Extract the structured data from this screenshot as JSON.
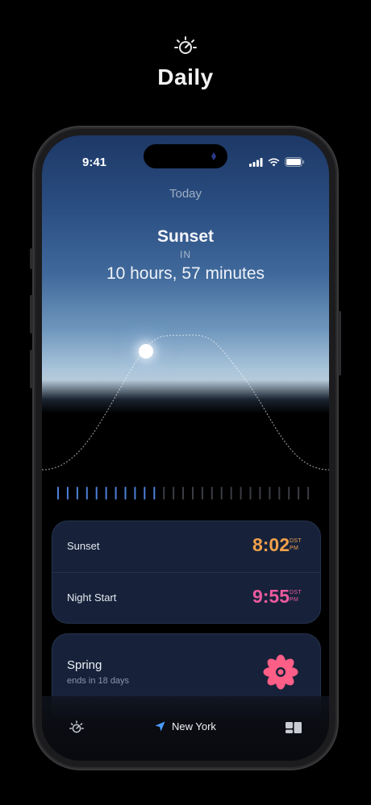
{
  "app": {
    "name": "Daily",
    "logo_icon": "sun-dial-icon"
  },
  "status_bar": {
    "time": "9:41"
  },
  "sky": {
    "day_label": "Today"
  },
  "event": {
    "title": "Sunset",
    "in_label": "IN",
    "countdown": "10 hours, 57 minutes"
  },
  "timeline": {
    "total_ticks": 27,
    "elapsed_ticks": 11,
    "elapsed_color": "#4d7fd6",
    "remaining_color": "#3a3d44"
  },
  "times": [
    {
      "label": "Sunset",
      "time": "8:02",
      "zone": "DST",
      "period": "PM",
      "color": "#f0a04b"
    },
    {
      "label": "Night Start",
      "time": "9:55",
      "zone": "DST",
      "period": "PM",
      "color": "#ec5a9e"
    }
  ],
  "season": {
    "name": "Spring",
    "subtitle": "ends in 18 days",
    "icon": "flower-icon",
    "icon_color": "#ff5e87"
  },
  "tab_bar": {
    "location": "New York",
    "left_icon": "sun-dial-icon",
    "location_icon": "location-arrow-icon",
    "right_icon": "widgets-icon",
    "location_color": "#4a9cff"
  }
}
